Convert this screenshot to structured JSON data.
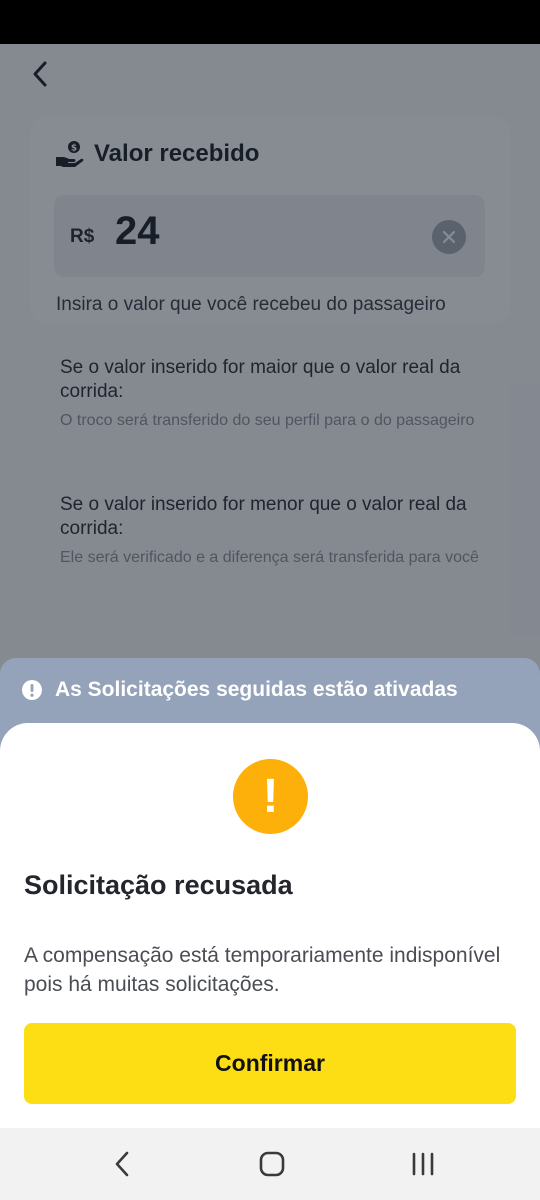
{
  "header": {
    "back_icon": "chevron-left-icon"
  },
  "card": {
    "title": "Valor recebido",
    "title_icon": "hand-coin-icon",
    "currency": "R$",
    "amount": "24",
    "clear_icon": "clear-x-icon",
    "helper": "Insira o valor que você recebeu do passageiro"
  },
  "info": [
    {
      "heading": "Se o valor inserido for maior que o valor real da corrida:",
      "detail": "O troco será transferido do seu perfil para o do passageiro"
    },
    {
      "heading": "Se o valor inserido for menor que o valor real da corrida:",
      "detail": "Ele será verificado e a diferença será transferida para você"
    }
  ],
  "banner": {
    "icon": "alert-circle-icon",
    "text": "As Solicitações seguidas estão ativadas"
  },
  "sheet": {
    "icon": "warning-icon",
    "icon_glyph": "!",
    "title": "Solicitação recusada",
    "description": "A compensação está temporariamente indisponível pois há muitas solicitações.",
    "confirm_label": "Confirmar"
  },
  "colors": {
    "accent_yellow": "#fddd14",
    "warning_orange": "#fdb00a",
    "banner_blue": "#94a3b9"
  },
  "system_nav": {
    "back": "nav-back-icon",
    "home": "nav-home-icon",
    "recents": "nav-recents-icon"
  }
}
